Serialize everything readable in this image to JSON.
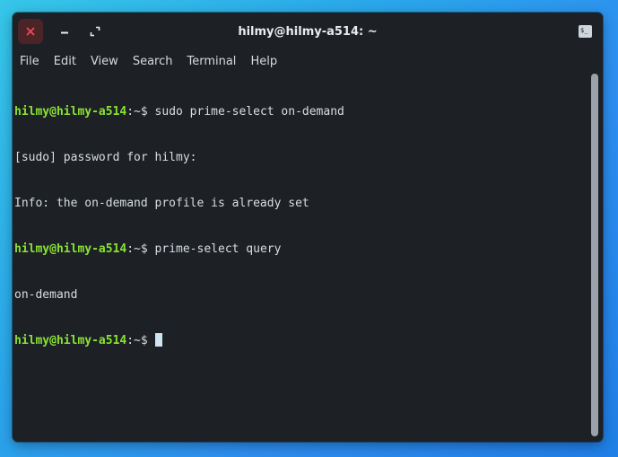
{
  "window": {
    "title": "hilmy@hilmy-a514: ~",
    "close_icon": "close-icon",
    "minimize_icon": "minimize-icon",
    "maximize_icon": "maximize-icon",
    "terminal_icon_text": "$_"
  },
  "menu": {
    "items": [
      "File",
      "Edit",
      "View",
      "Search",
      "Terminal",
      "Help"
    ]
  },
  "terminal": {
    "lines": [
      {
        "type": "prompt",
        "user": "hilmy@hilmy-a514",
        "path": ":~$ ",
        "command": "sudo prime-select on-demand"
      },
      {
        "type": "output",
        "text": "[sudo] password for hilmy:"
      },
      {
        "type": "output",
        "text": "Info: the on-demand profile is already set"
      },
      {
        "type": "prompt",
        "user": "hilmy@hilmy-a514",
        "path": ":~$ ",
        "command": "prime-select query"
      },
      {
        "type": "output",
        "text": "on-demand"
      },
      {
        "type": "prompt",
        "user": "hilmy@hilmy-a514",
        "path": ":~$ ",
        "command": ""
      }
    ]
  },
  "colors": {
    "window_bg": "#1d2125",
    "prompt_user": "#8ae234",
    "text": "#d8dde2",
    "close_button_bg": "#4a2426",
    "close_x": "#f04a50"
  }
}
